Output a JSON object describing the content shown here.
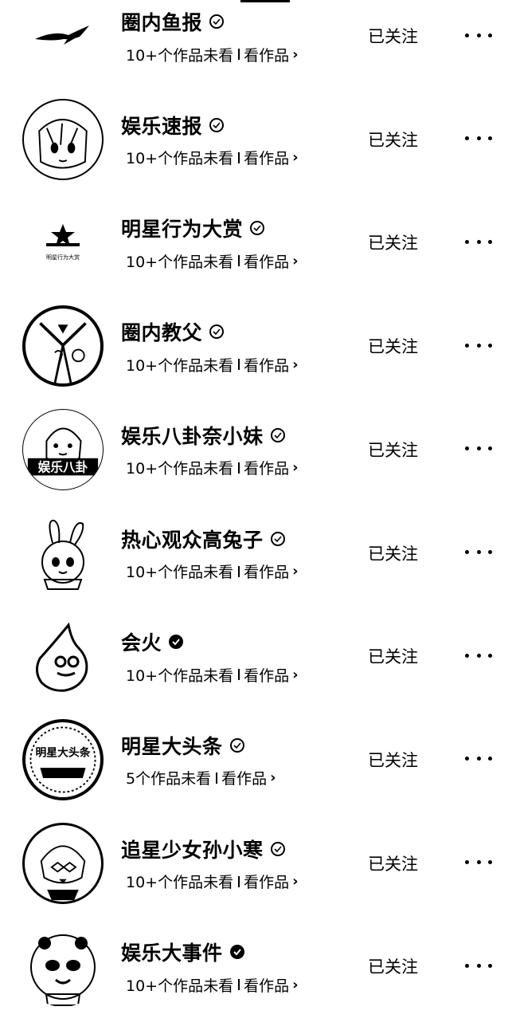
{
  "list": {
    "items": [
      {
        "name": "圈内鱼报",
        "badge": "verified-outline",
        "unseen": "10+个作品未看",
        "view": "看作品",
        "follow": "已关注",
        "avatar": "fish-avatar"
      },
      {
        "name": "娱乐速报",
        "badge": "verified-outline",
        "unseen": "10+个作品未看",
        "view": "看作品",
        "follow": "已关注",
        "avatar": "anime-girl-avatar"
      },
      {
        "name": "明星行为大赏",
        "badge": "verified-outline",
        "unseen": "10+个作品未看",
        "view": "看作品",
        "follow": "已关注",
        "avatar": "star-logo-avatar",
        "avatar_text": "明星行为大赏"
      },
      {
        "name": "圈内教父",
        "badge": "verified-outline",
        "unseen": "10+个作品未看",
        "view": "看作品",
        "follow": "已关注",
        "avatar": "suit-man-avatar"
      },
      {
        "name": "娱乐八卦奈小妹",
        "badge": "verified-outline",
        "unseen": "10+个作品未看",
        "view": "看作品",
        "follow": "已关注",
        "avatar": "gossip-girl-avatar",
        "avatar_text": "娱乐八卦"
      },
      {
        "name": "热心观众高兔子",
        "badge": "verified-outline",
        "unseen": "10+个作品未看",
        "view": "看作品",
        "follow": "已关注",
        "avatar": "rabbit-girl-avatar"
      },
      {
        "name": "会火",
        "badge": "verified-filled",
        "unseen": "10+个作品未看",
        "view": "看作品",
        "follow": "已关注",
        "avatar": "flame-avatar"
      },
      {
        "name": "明星大头条",
        "badge": "verified-outline",
        "unseen": "5个作品未看",
        "view": "看作品",
        "follow": "已关注",
        "avatar": "headline-badge-avatar",
        "avatar_text": "明星大头条"
      },
      {
        "name": "追星少女孙小寒",
        "badge": "verified-outline",
        "unseen": "10+个作品未看",
        "view": "看作品",
        "follow": "已关注",
        "avatar": "fan-girl-avatar"
      },
      {
        "name": "娱乐大事件",
        "badge": "verified-filled",
        "unseen": "10+个作品未看",
        "view": "看作品",
        "follow": "已关注",
        "avatar": "panda-avatar"
      }
    ]
  }
}
